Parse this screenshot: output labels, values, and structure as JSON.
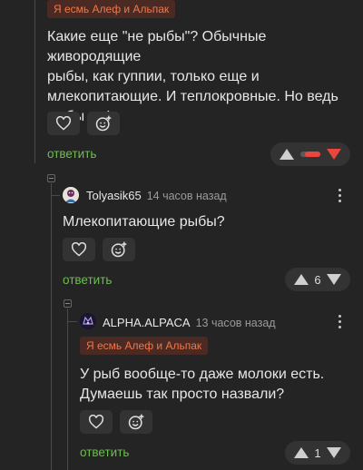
{
  "comment1": {
    "tag": "Я есмь Алеф и Альпак",
    "lines": [
      "Какие еще \"не рыбы\"? Обычные живородящие",
      "рыбы, как гуппии, только еще и",
      "млекопитающие. И теплокровные. Но ведь",
      "рыбы же!"
    ],
    "reply_label": "ответить"
  },
  "comment2": {
    "author": "Tolyasik65",
    "time": "14 часов назад",
    "text": "Млекопитающие рыбы?",
    "reply_label": "ответить",
    "rating": "6"
  },
  "comment3": {
    "author": "ALPHA.ALPACA",
    "time": "13 часов назад",
    "tag": "Я есмь Алеф и Альпак",
    "lines": [
      "У рыб вообще-то даже молоки есть.",
      "Думаешь так просто назвали?"
    ],
    "reply_label": "ответить",
    "rating": "1"
  },
  "colors": {
    "accent_green": "#6ebd51",
    "tag_text": "#f0784a",
    "downvote": "#e9473d"
  }
}
